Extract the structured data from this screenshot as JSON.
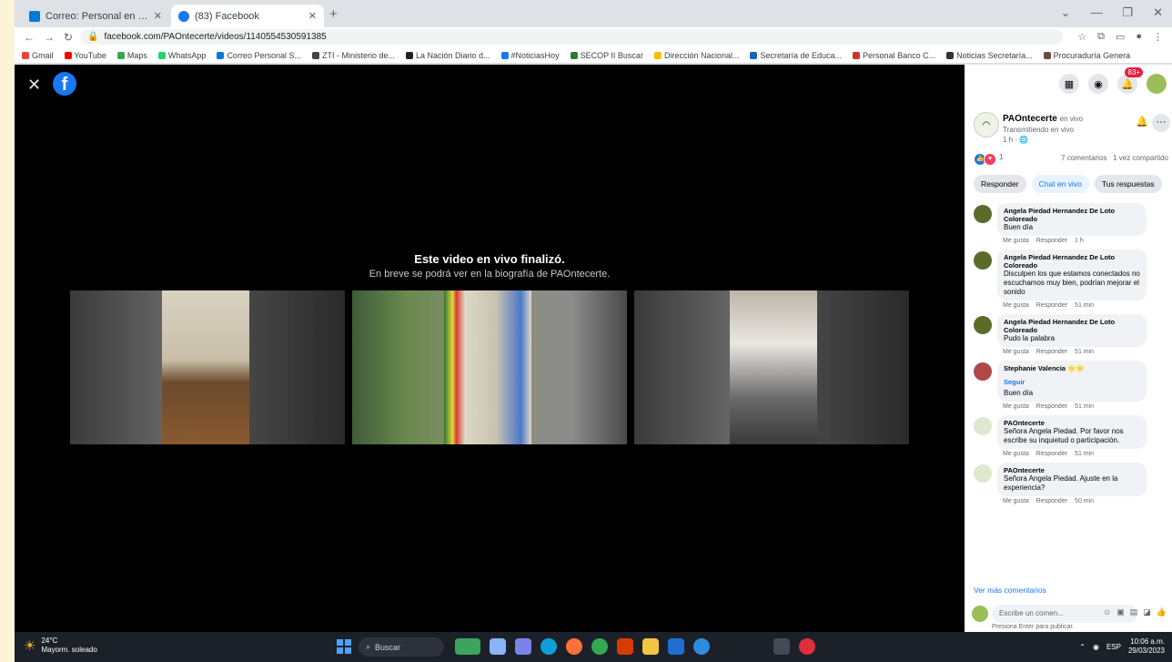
{
  "browser": {
    "tabs": [
      {
        "title": "Correo: Personal en Outlook",
        "state": "inactive",
        "favicon_color": "#0078d4"
      },
      {
        "title": "(83) Facebook",
        "state": "active",
        "favicon_color": "#1877f2"
      }
    ],
    "url": "facebook.com/PAOntecerte/videos/1140554530591385",
    "bookmarks": [
      {
        "label": "Gmail",
        "color": "#ea4335"
      },
      {
        "label": "YouTube",
        "color": "#ff0000"
      },
      {
        "label": "Maps",
        "color": "#34a853"
      },
      {
        "label": "WhatsApp",
        "color": "#25d366"
      },
      {
        "label": "Correo Personal S...",
        "color": "#0078d4"
      },
      {
        "label": "ZTI - Ministerio de...",
        "color": "#444444"
      },
      {
        "label": "La Nación Diario d...",
        "color": "#222222"
      },
      {
        "label": "#NoticiasHoy",
        "color": "#1877f2"
      },
      {
        "label": "SECOP II Buscar",
        "color": "#2e7d32"
      },
      {
        "label": "Dirección Nacional...",
        "color": "#fbbc05"
      },
      {
        "label": "Secretaría de Educa...",
        "color": "#1565c0"
      },
      {
        "label": "Personal Banco C...",
        "color": "#d32f2f"
      },
      {
        "label": "Noticias Secretaría...",
        "color": "#333333"
      },
      {
        "label": "Procuraduría Genera",
        "color": "#6d4c41"
      }
    ]
  },
  "viewer": {
    "ended_title": "Este video en vivo finalizó.",
    "ended_subtitle": "En breve se podrá ver en la biografía de PAOntecerte."
  },
  "sidebar": {
    "notification_count": "83+",
    "page_name": "PAOntecerte",
    "page_status": "en vivo",
    "page_subtitle": "Transmitiendo en vivo",
    "page_meta": "1 h · 🌐",
    "reaction_count": "1",
    "comment_count": "7 comentarios",
    "share_count": "1 vez compartido",
    "buttons": [
      "Responder",
      "Chat en vivo",
      "Tus respuestas"
    ],
    "comments": [
      {
        "author": "Angela Piedad Hernandez De Loto Coloreado",
        "text": "Buen día",
        "time": "1 h",
        "avatar_color": "#5b6b2a"
      },
      {
        "author": "Angela Piedad Hernandez De Loto Coloreado",
        "text": "Disculpen los que estamos conectados no escuchamos muy bien, podrían mejorar el sonido",
        "time": "51 min",
        "avatar_color": "#5b6b2a"
      },
      {
        "author": "Angela Piedad Hernandez De Loto Coloreado",
        "text": "Pudo la palabra",
        "time": "51 min",
        "avatar_color": "#5b6b2a"
      },
      {
        "author": "Stephanie Valencia 🌟🌟",
        "text": "Buen día",
        "time": "51 min",
        "avatar_color": "#b0484a",
        "follow": "Seguir"
      },
      {
        "author": "PAOntecerte",
        "text": "Señora Angela Piedad. Por favor nos escribe su inquietud o participación.",
        "time": "51 min",
        "avatar_color": "#dfe8cf"
      },
      {
        "author": "PAOntecerte",
        "text": "Señora Angela Piedad. Ajuste en la experiencia?",
        "time": "50 min",
        "avatar_color": "#dfe8cf"
      }
    ],
    "comment_actions": {
      "like": "Me gusta",
      "reply": "Responder"
    },
    "view_more": "Ver más comentarios",
    "write_placeholder": "Escribe un comen...",
    "write_hint": "Presiona Enter para publicar."
  },
  "taskbar": {
    "temperature": "24°C",
    "weather_text": "Mayorm. soleado",
    "search_label": "Buscar",
    "language": "ESP",
    "time": "10:06 a.m.",
    "date": "29/03/2023"
  }
}
